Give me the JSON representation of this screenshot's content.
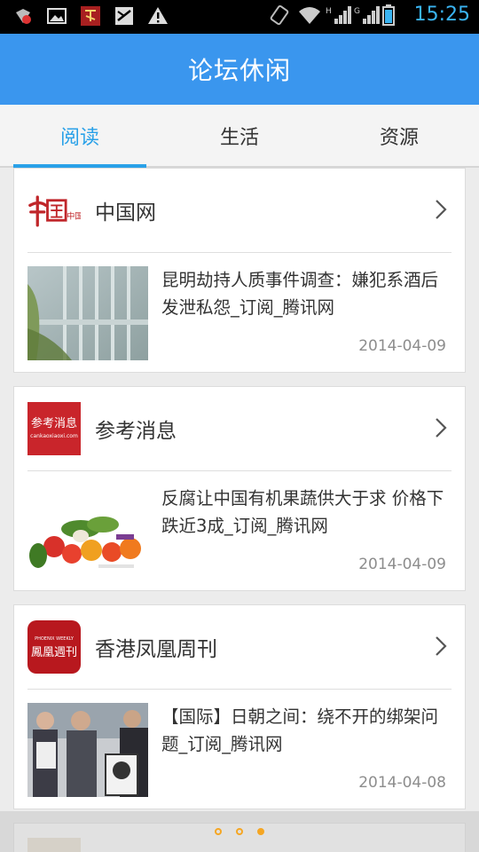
{
  "status_bar": {
    "time": "15:25",
    "icons": [
      "vpn-icon",
      "image-icon",
      "game-icon",
      "mail-icon",
      "warning-icon",
      "rotate-icon",
      "wifi-icon",
      "signal-icon",
      "signal-icon",
      "battery-icon"
    ]
  },
  "header": {
    "title": "论坛休闲"
  },
  "tabs": [
    {
      "label": "阅读",
      "active": true
    },
    {
      "label": "生活",
      "active": false
    },
    {
      "label": "资源",
      "active": false
    }
  ],
  "cards": [
    {
      "source": "中国网",
      "logo_text": "中国网",
      "headline": "昆明劫持人质事件调查：嫌犯系酒后发泄私怨_订阅_腾讯网",
      "date": "2014-04-09"
    },
    {
      "source": "参考消息",
      "logo_text": "参考消息",
      "logo_sub": "cankaoxiaoxi.com",
      "headline": "反腐让中国有机果蔬供大于求 价格下跌近3成_订阅_腾讯网",
      "date": "2014-04-09"
    },
    {
      "source": "香港凤凰周刊",
      "logo_text": "鳳凰週刊",
      "logo_sub": "PHOENIX WEEKLY",
      "headline": "【国际】日朝之间：绕不开的绑架问题_订阅_腾讯网",
      "date": "2014-04-08"
    }
  ],
  "pager": {
    "total": 3,
    "current": 3
  },
  "colors": {
    "accent": "#2aa1e8",
    "titlebar": "#3a96ee",
    "time": "#3ab4f2",
    "pager": "#f5a623"
  }
}
